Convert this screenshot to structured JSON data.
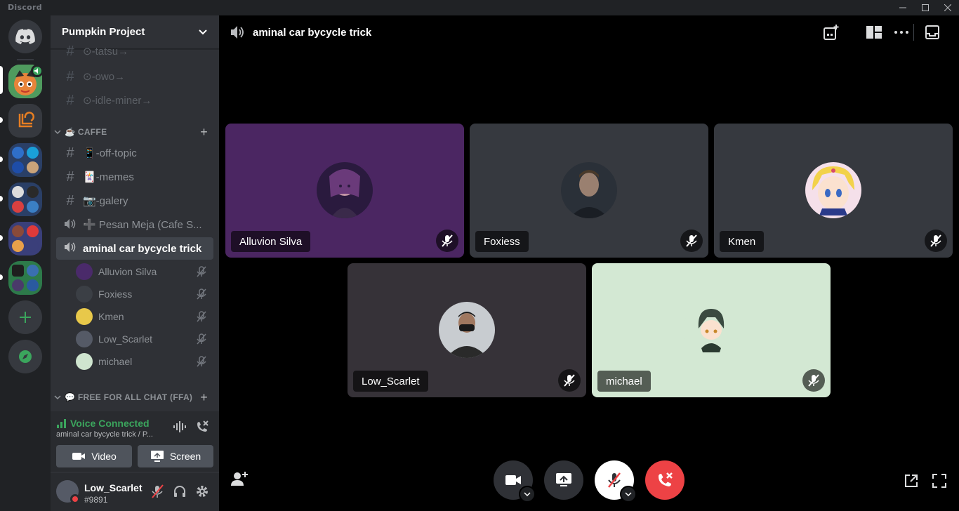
{
  "app": {
    "title": "Discord"
  },
  "server": {
    "name": "Pumpkin Project"
  },
  "channels_top": [
    {
      "name": "⊙-tatsu→"
    },
    {
      "name": "⊙-owo→"
    },
    {
      "name": "⊙-idle-miner→"
    }
  ],
  "categories": {
    "caffe": {
      "label": "☕ CAFFE"
    },
    "ffa": {
      "label": "💬 FREE FOR ALL CHAT (FFA)"
    }
  },
  "caffe_channels": [
    {
      "name": "📱-off-topic",
      "type": "text"
    },
    {
      "name": "🃏-memes",
      "type": "text"
    },
    {
      "name": "📷-galery",
      "type": "text"
    },
    {
      "name": "➕ Pesan Meja (Cafe S...",
      "type": "voice"
    },
    {
      "name": "aminal car bycycle trick",
      "type": "voice"
    }
  ],
  "voice_members": [
    {
      "name": "Alluvion Silva",
      "color": "#4a2a6a"
    },
    {
      "name": "Foxiess",
      "color": "#3b3f45"
    },
    {
      "name": "Kmen",
      "color": "#e8c84a"
    },
    {
      "name": "Low_Scarlet",
      "color": "#555a66"
    },
    {
      "name": "michael",
      "color": "#cfe5cf"
    }
  ],
  "voice_panel": {
    "status": "Voice Connected",
    "location": "aminal car bycycle trick / P...",
    "video_label": "Video",
    "screen_label": "Screen"
  },
  "user": {
    "name": "Low_Scarlet",
    "tag": "#9891"
  },
  "call": {
    "title": "aminal car bycycle trick",
    "tiles": [
      {
        "name": "Alluvion Silva",
        "bg": "#4b2662"
      },
      {
        "name": "Foxiess",
        "bg": "#36393f"
      },
      {
        "name": "Kmen",
        "bg": "#36393f"
      },
      {
        "name": "Low_Scarlet",
        "bg": "#363238"
      },
      {
        "name": "michael",
        "bg": "#d3e8d3"
      }
    ]
  },
  "colors": {
    "green": "#3ba55d",
    "red": "#ed4245",
    "blurple": "#5865f2"
  },
  "icons": [
    "discord-logo-icon",
    "speaker-icon",
    "hashtag-icon",
    "plus-icon",
    "chevron-down-icon",
    "muted-mic-icon",
    "headphones-icon",
    "gear-icon",
    "signal-bars-icon",
    "soundwave-icon",
    "disconnect-icon",
    "camera-icon",
    "screen-share-icon",
    "end-call-icon",
    "add-user-icon",
    "popout-icon",
    "fullscreen-icon",
    "activity-icon",
    "grid-layout-icon",
    "more-icon",
    "inbox-icon",
    "compass-icon"
  ]
}
